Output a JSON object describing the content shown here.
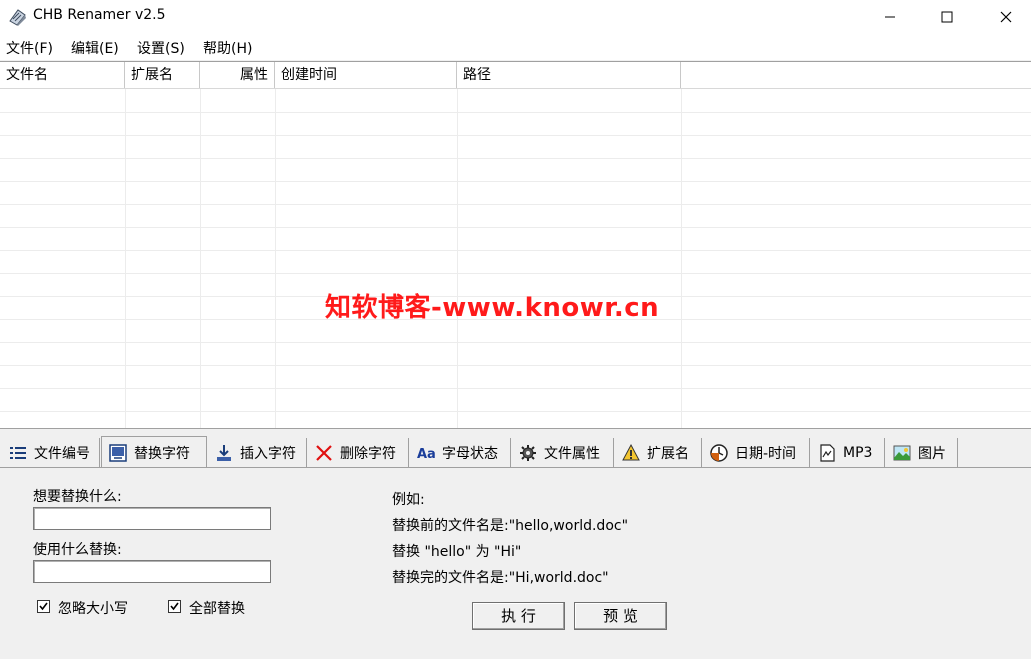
{
  "window": {
    "title": "CHB Renamer v2.5"
  },
  "menu": [
    "文件(F)",
    "编辑(E)",
    "设置(S)",
    "帮助(H)"
  ],
  "list": {
    "columns": [
      "文件名",
      "扩展名",
      "属性",
      "创建时间",
      "路径"
    ]
  },
  "watermark": "知软博客-www.knowr.cn",
  "tabs": [
    "文件编号",
    "替换字符",
    "插入字符",
    "删除字符",
    "字母状态",
    "文件属性",
    "扩展名",
    "日期-时间",
    "MP3",
    "图片"
  ],
  "replace_panel": {
    "find_label": "想要替换什么:",
    "find_value": "",
    "replace_label": "使用什么替换:",
    "replace_value": "",
    "ignore_case_label": "忽略大小写",
    "ignore_case_checked": true,
    "replace_all_label": "全部替换",
    "replace_all_checked": true,
    "example_title": "例如:",
    "example_line1": "替换前的文件名是:\"hello,world.doc\"",
    "example_line2": "替换 \"hello\" 为 \"Hi\"",
    "example_line3": "替换完的文件名是:\"Hi,world.doc\"",
    "execute_label": "执 行",
    "preview_label": "预 览"
  }
}
